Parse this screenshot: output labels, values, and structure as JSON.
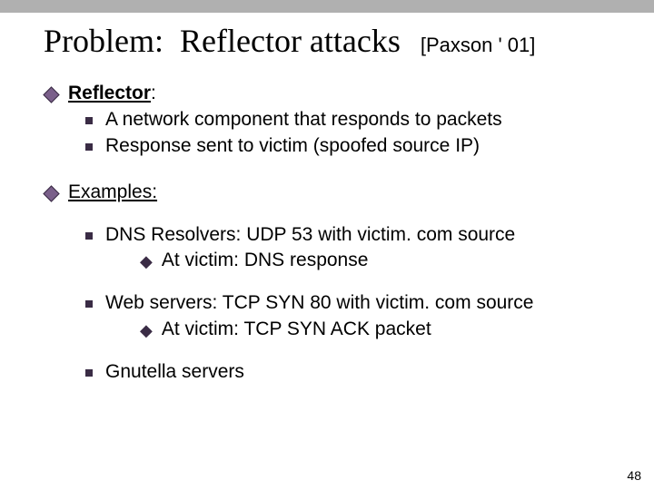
{
  "title": {
    "left": "Problem:",
    "right": "Reflector attacks",
    "cite": "[Paxson ' 01]"
  },
  "section1": {
    "heading": "Reflector",
    "colon": ":",
    "items": [
      "A network component that responds to packets",
      "Response sent to victim   (spoofed source IP)"
    ]
  },
  "section2": {
    "heading": "Examples:",
    "examples": [
      {
        "line": "DNS Resolvers:    UDP 53 with victim. com source",
        "sub": "At victim:    DNS response"
      },
      {
        "line": "Web servers:   TCP SYN 80 with victim. com source",
        "sub": "At victim:    TCP SYN ACK packet"
      },
      {
        "line": "Gnutella servers",
        "sub": null
      }
    ]
  },
  "pagenum": "48"
}
